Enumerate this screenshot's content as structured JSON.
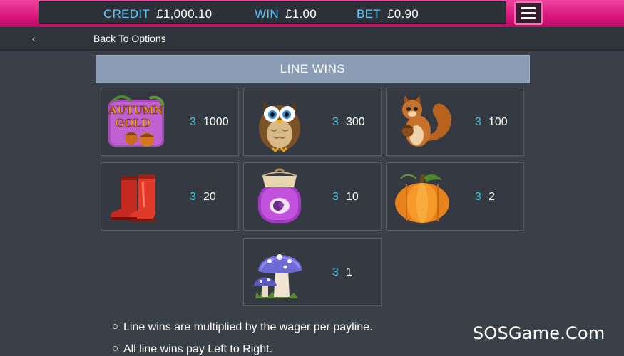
{
  "meters": {
    "credit_label": "CREDIT",
    "credit_value": "£1,000.10",
    "win_label": "WIN",
    "win_value": "£1.00",
    "bet_label": "BET",
    "bet_value": "£0.90"
  },
  "nav": {
    "back_icon": "chevron-left-icon",
    "back_glyph": "‹",
    "back_label": "Back To Options",
    "menu_icon": "hamburger-menu-icon"
  },
  "section": {
    "title": "LINE WINS"
  },
  "paytable": [
    {
      "symbol": "autumn-gold-logo",
      "logo_text_1": "AUTUMN",
      "logo_text_2": "GOLD",
      "count": "3",
      "payout": "1000"
    },
    {
      "symbol": "owl",
      "count": "3",
      "payout": "300"
    },
    {
      "symbol": "squirrel",
      "count": "3",
      "payout": "100"
    },
    {
      "symbol": "rain-boots",
      "count": "3",
      "payout": "20"
    },
    {
      "symbol": "jam-jar",
      "count": "3",
      "payout": "10"
    },
    {
      "symbol": "pumpkin",
      "count": "3",
      "payout": "2"
    },
    {
      "symbol": "mushrooms",
      "count": "3",
      "payout": "1"
    }
  ],
  "notes": [
    "Line wins are multiplied by the wager per payline.",
    "All line wins pay Left to Right."
  ],
  "watermark": "SOSGame.Com",
  "colors": {
    "accent_pink": "#e0267f",
    "label_blue": "#5ec8ff",
    "count_cyan": "#43c7e8",
    "band": "#8a9db4"
  }
}
